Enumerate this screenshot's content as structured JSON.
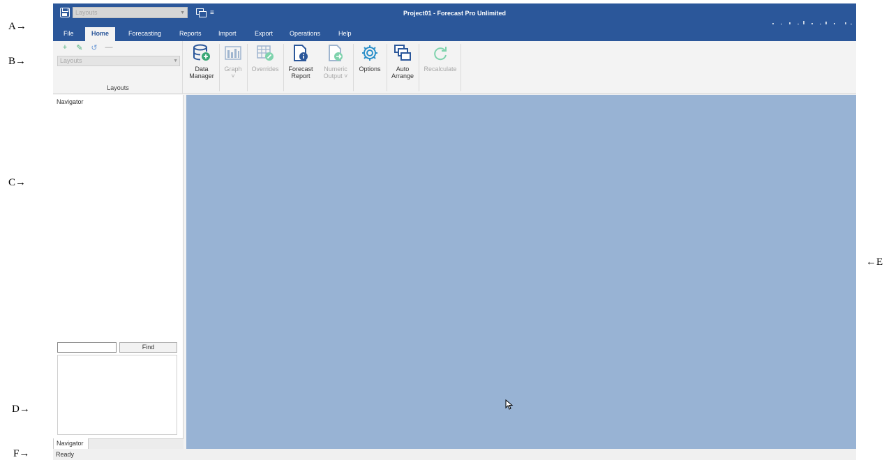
{
  "annotations": {
    "a": "A→",
    "b": "B→",
    "c": "C→",
    "d": "D→",
    "e": "←E",
    "f": "F→"
  },
  "titlebar": {
    "qat_layouts_value": "Layouts",
    "window_title": "Project01 - Forecast Pro Unlimited"
  },
  "ribbon_tabs": [
    "File",
    "Home",
    "Forecasting",
    "Reports",
    "Import",
    "Export",
    "Operations",
    "Help"
  ],
  "active_tab": "Home",
  "layouts_group": {
    "combo_value": "Layouts",
    "group_label": "Layouts",
    "tools": [
      "add-icon",
      "edit-icon",
      "undo-icon",
      "remove-icon"
    ]
  },
  "ribbon_buttons": [
    {
      "label": "Data Manager",
      "line1": "Data",
      "line2": "Manager",
      "icon": "database-add-icon",
      "enabled": true
    },
    {
      "label": "Graph",
      "line1": "Graph",
      "line2": "˅",
      "icon": "bar-chart-icon",
      "enabled": false
    },
    {
      "label": "Overrides",
      "line1": "Overrides",
      "line2": "",
      "icon": "table-edit-icon",
      "enabled": false
    },
    {
      "label": "Forecast Report",
      "line1": "Forecast",
      "line2": "Report",
      "icon": "report-info-icon",
      "enabled": true
    },
    {
      "label": "Numeric Output",
      "line1": "Numeric",
      "line2": "Output ˅",
      "icon": "export-doc-icon",
      "enabled": false
    },
    {
      "label": "Options",
      "line1": "Options",
      "line2": "",
      "icon": "gear-icon",
      "enabled": true
    },
    {
      "label": "Auto Arrange",
      "line1": "Auto",
      "line2": "Arrange",
      "icon": "windows-cascade-icon",
      "enabled": true
    },
    {
      "label": "Recalculate",
      "line1": "Recalculate",
      "line2": "",
      "icon": "refresh-icon",
      "enabled": false
    }
  ],
  "navigator": {
    "title": "Navigator",
    "find_label": "Find",
    "find_value": "",
    "tab_label": "Navigator"
  },
  "status": {
    "text": "Ready"
  },
  "colors": {
    "titlebar": "#2b579a",
    "workspace": "#98b3d4",
    "icon_blue": "#2b579a",
    "icon_green": "#3aa776",
    "icon_disabled": "#9fb5cf"
  }
}
